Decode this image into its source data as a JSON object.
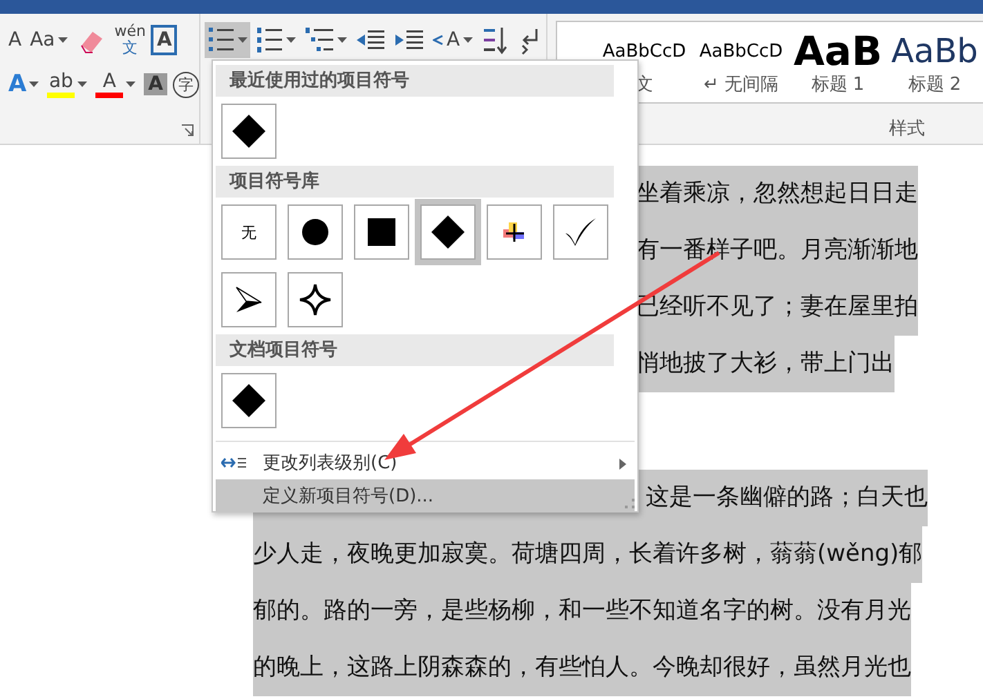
{
  "ribbon": {
    "font_group": {
      "row1": [
        {
          "kind": "shrink_font",
          "text": "A"
        },
        {
          "kind": "change_case",
          "text": "Aa",
          "dropdown": true
        },
        {
          "kind": "clear_format"
        },
        {
          "kind": "phonetic",
          "text": "wén",
          "sub": "文"
        },
        {
          "kind": "char_border",
          "text": "A"
        }
      ],
      "row2": [
        {
          "kind": "text_effect",
          "text": "A",
          "dropdown": true
        },
        {
          "kind": "highlight",
          "text": "ab",
          "dropdown": true
        },
        {
          "kind": "font_color",
          "text": "A",
          "dropdown": true
        },
        {
          "kind": "char_shading",
          "text": "A"
        },
        {
          "kind": "enclose",
          "text": "字"
        }
      ]
    },
    "paragraph_group": {
      "row1": [
        {
          "kind": "bullets",
          "dropdown": true,
          "selected": true
        },
        {
          "kind": "numbering",
          "dropdown": true,
          "selected": false
        },
        {
          "kind": "multilevel",
          "dropdown": true,
          "selected": false
        },
        {
          "kind": "outdent",
          "selected": false
        },
        {
          "kind": "indent",
          "selected": false
        },
        {
          "kind": "asian_layout",
          "text": "A",
          "dropdown": true,
          "selected": false
        },
        {
          "kind": "sort",
          "selected": false
        },
        {
          "kind": "show_marks",
          "selected": false
        }
      ]
    },
    "styles_group": {
      "label": "样式",
      "styles": [
        {
          "sample": "AaBbCcD",
          "name": "文",
          "kind": "normal"
        },
        {
          "sample": "AaBbCcD",
          "name": "↵ 无间隔",
          "kind": "normal"
        },
        {
          "sample": "AaB",
          "name": "标题 1",
          "kind": "heading1"
        },
        {
          "sample": "AaBb",
          "name": "标题 2",
          "kind": "heading2"
        }
      ]
    }
  },
  "bullet_menu": {
    "sections": [
      {
        "title": "最近使用过的项目符号",
        "tiles": [
          {
            "kind": "diamond",
            "selected": false
          }
        ]
      },
      {
        "title": "项目符号库",
        "tiles": [
          {
            "kind": "none",
            "text": "无",
            "selected": false
          },
          {
            "kind": "circle",
            "selected": false
          },
          {
            "kind": "square",
            "selected": false
          },
          {
            "kind": "diamond",
            "selected": true
          },
          {
            "kind": "picture",
            "selected": false
          },
          {
            "kind": "check",
            "selected": false
          },
          {
            "kind": "arrowhead",
            "selected": false
          },
          {
            "kind": "star",
            "selected": false
          }
        ]
      },
      {
        "title": "文档项目符号",
        "tiles": [
          {
            "kind": "diamond",
            "selected": false
          }
        ]
      }
    ],
    "items": [
      {
        "label": "更改列表级别(C)",
        "kind": "list_level",
        "submenu": true,
        "selected": false
      },
      {
        "label": "定义新项目符号(D)...",
        "kind": "define",
        "submenu": false,
        "selected": true
      }
    ]
  },
  "document": {
    "paragraphs": [
      {
        "lines": [
          "坐着乘凉，忽然想起日日走",
          "有一番样子吧。月亮渐渐地",
          "已经听不见了；妻在屋里拍",
          "悄地披了大衫，带上门出"
        ]
      },
      {
        "lines": [
          "这是一条幽僻的路；白天也",
          "少人走，夜晚更加寂寞。荷塘四周，长着许多树，蓊蓊(wěng)郁",
          "郁的。路的一旁，是些杨柳，和一些不知道名字的树。没有月光",
          "的晚上，这路上阴森森的，有些怕人。今晚却很好，虽然月光也"
        ]
      }
    ]
  }
}
